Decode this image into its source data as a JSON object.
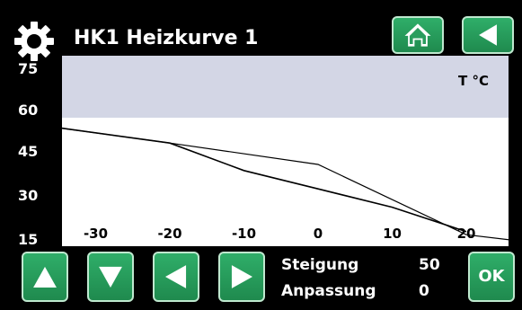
{
  "header": {
    "title": "HK1 Heizkurve 1",
    "settings_icon": "gear-icon",
    "home_icon": "home-icon",
    "back_icon": "back-arrow-icon"
  },
  "plot": {
    "unit_label": "T °C",
    "y_ticks": [
      "75",
      "60",
      "45",
      "30",
      "15"
    ],
    "x_ticks": [
      "-30",
      "-20",
      "-10",
      "0",
      "10",
      "20"
    ]
  },
  "params": {
    "steigung_label": "Steigung",
    "steigung_value": "50",
    "anpassung_label": "Anpassung",
    "anpassung_value": "0"
  },
  "controls": {
    "up_icon": "up-arrow-icon",
    "down_icon": "down-arrow-icon",
    "left_icon": "left-arrow-icon",
    "right_icon": "right-arrow-icon",
    "ok_label": "OK"
  },
  "colors": {
    "button_green": "#2fae69",
    "band": "#d3d6e5"
  },
  "chart_data": {
    "type": "line",
    "xlabel": "",
    "ylabel": "",
    "series": [
      {
        "x": [
          -35,
          -20,
          0,
          20,
          27
        ],
        "y": [
          57,
          52,
          45,
          22,
          20
        ]
      },
      {
        "x": [
          -35,
          -20,
          -10,
          0,
          10,
          20
        ],
        "y": [
          57,
          52,
          43,
          37,
          31,
          23
        ]
      }
    ]
  }
}
